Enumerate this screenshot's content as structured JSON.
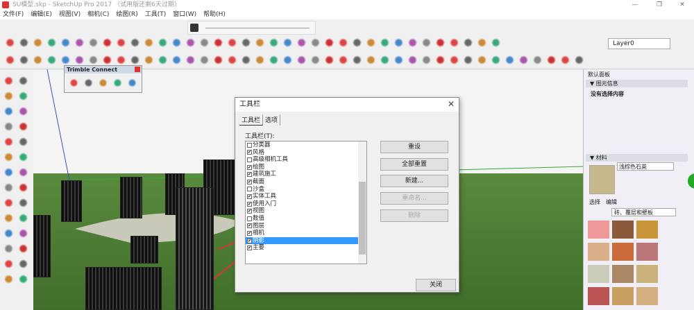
{
  "window": {
    "title": "SU模型.skp - SketchUp Pro 2017 （试用版还剩6天过期）",
    "min": "—",
    "max": "❐",
    "close": "✕"
  },
  "menu": [
    "文件(F)",
    "编辑(E)",
    "视图(V)",
    "相机(C)",
    "绘图(R)",
    "工具(T)",
    "窗口(W)",
    "帮助(H)"
  ],
  "toolbar": {
    "layer": "Layer0",
    "row1_icons": [
      "select-icon",
      "eraser-icon",
      "paint-bucket-icon",
      "rotate-icon",
      "pencil-icon",
      "freehand-icon",
      "rectangle-icon",
      "circle-icon",
      "polygon-icon",
      "arc-icon",
      "arc2-icon",
      "arc3-icon",
      "move-icon",
      "push-pull-icon",
      "rotate-icon",
      "follow-me-icon",
      "scale-icon",
      "offset-icon",
      "tape-measure-icon",
      "dimension-icon",
      "protractor-icon",
      "text-icon",
      "axes-icon",
      "3d-text-icon",
      "orbit-icon",
      "pan-icon",
      "zoom-icon",
      "zoom-window-icon",
      "zoom-extents-icon",
      "walk-icon",
      "look-around-icon",
      "position-camera-icon",
      "section-plane-icon",
      "section-display-icon",
      "section-cut-icon",
      "section-fill-icon"
    ],
    "row2_icons": [
      "select-icon",
      "eraser-icon",
      "freehand-icon",
      "line-icon",
      "rectangle-icon",
      "pie-icon",
      "circle-icon",
      "arc-icon",
      "polygon-icon",
      "tape-icon",
      "text-icon",
      "paint-icon",
      "move-icon",
      "push-pull-icon",
      "zoom-icon",
      "scale-icon",
      "follow-me-icon",
      "iso-view-icon",
      "top-view-icon",
      "front-view-icon",
      "right-view-icon",
      "warehouse-icon",
      "xray-icon",
      "back-edges-icon",
      "wireframe-icon",
      "hidden-line-icon",
      "shaded-icon",
      "textured-icon",
      "monochrome-icon",
      "house-icon",
      "house2-icon",
      "house3-icon",
      "house4-icon",
      "house5-icon",
      "component-icon",
      "group-icon",
      "solid-icon",
      "intersect-icon",
      "union-icon",
      "subtract-icon",
      "trim-icon",
      "split-icon"
    ]
  },
  "trimble": {
    "title": "Trimble Connect",
    "icons": [
      "cube-icon",
      "mail-icon",
      "cloud-upload-icon",
      "share-icon",
      "sync-icon"
    ]
  },
  "dialog": {
    "title": "工具栏",
    "close": "✕",
    "tabs": [
      "工具栏",
      "选项"
    ],
    "list_label": "工具栏(T):",
    "items": [
      {
        "label": "分类器",
        "checked": false
      },
      {
        "label": "风格",
        "checked": true
      },
      {
        "label": "高级相机工具",
        "checked": false
      },
      {
        "label": "绘图",
        "checked": true
      },
      {
        "label": "建筑施工",
        "checked": true
      },
      {
        "label": "截面",
        "checked": true
      },
      {
        "label": "沙盒",
        "checked": false
      },
      {
        "label": "实体工具",
        "checked": true
      },
      {
        "label": "使用入门",
        "checked": true
      },
      {
        "label": "视图",
        "checked": true
      },
      {
        "label": "数值",
        "checked": false
      },
      {
        "label": "图层",
        "checked": true
      },
      {
        "label": "相机",
        "checked": true
      },
      {
        "label": "阴影",
        "checked": true,
        "selected": true
      },
      {
        "label": "主要",
        "checked": true
      }
    ],
    "buttons": {
      "reset": "重设",
      "reset_all": "全部重置",
      "new": "新建...",
      "rename": "重命名...",
      "delete": "删除",
      "close": "关闭"
    }
  },
  "panel": {
    "title": "默认面板",
    "entity_info": {
      "header": "图元信息",
      "text": "没有选择内容"
    },
    "materials": {
      "header": "材料",
      "name": "浅棕色石英",
      "tabs": [
        "选择",
        "编辑"
      ],
      "category": "砖、覆层和壁板"
    }
  },
  "colors": {
    "accent": "#3399ff",
    "ground": "#4a7d34"
  }
}
